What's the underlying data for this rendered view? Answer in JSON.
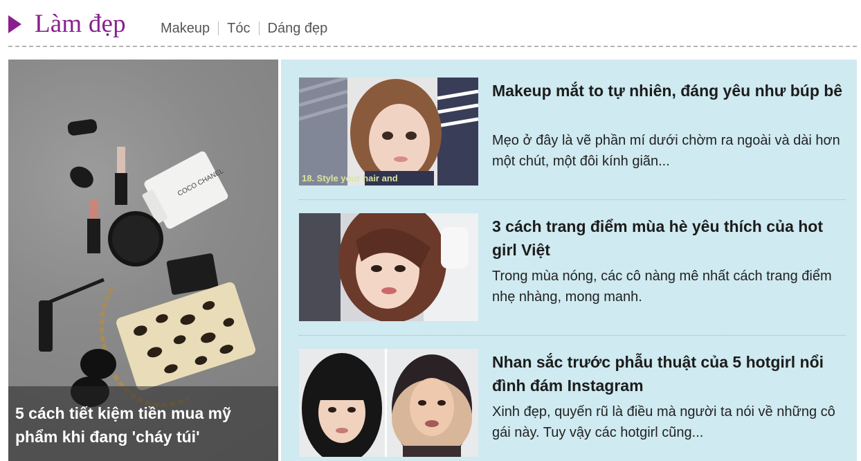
{
  "header": {
    "title": "Làm đẹp",
    "nav": [
      "Makeup",
      "Tóc",
      "Dáng đẹp"
    ]
  },
  "featured": {
    "title": "5 cách tiết kiệm tiền mua mỹ phẩm khi đang 'cháy túi'",
    "product_label": "COCO CHANEL"
  },
  "articles": [
    {
      "title": "Makeup mắt to tự nhiên, đáng yêu như búp bê",
      "desc": "Mẹo ở đây là vẽ phần mí dưới chờm ra ngoài và dài hơn một chút, một đôi kính giãn...",
      "thumb_caption": "18. Style your hair and"
    },
    {
      "title": "3 cách trang điểm mùa hè yêu thích của hot girl Việt",
      "desc": "Trong mùa nóng, các cô nàng mê nhất cách trang điểm nhẹ nhàng, mong manh."
    },
    {
      "title": "Nhan sắc trước phẫu thuật của 5 hotgirl nổi đình đám Instagram",
      "desc": "Xinh đẹp, quyến rũ là điều mà người ta nói về những cô gái này. Tuy vậy các hotgirl cũng..."
    }
  ],
  "colors": {
    "accent": "#8b1f8f",
    "panel_bg": "#cfeaf0"
  }
}
